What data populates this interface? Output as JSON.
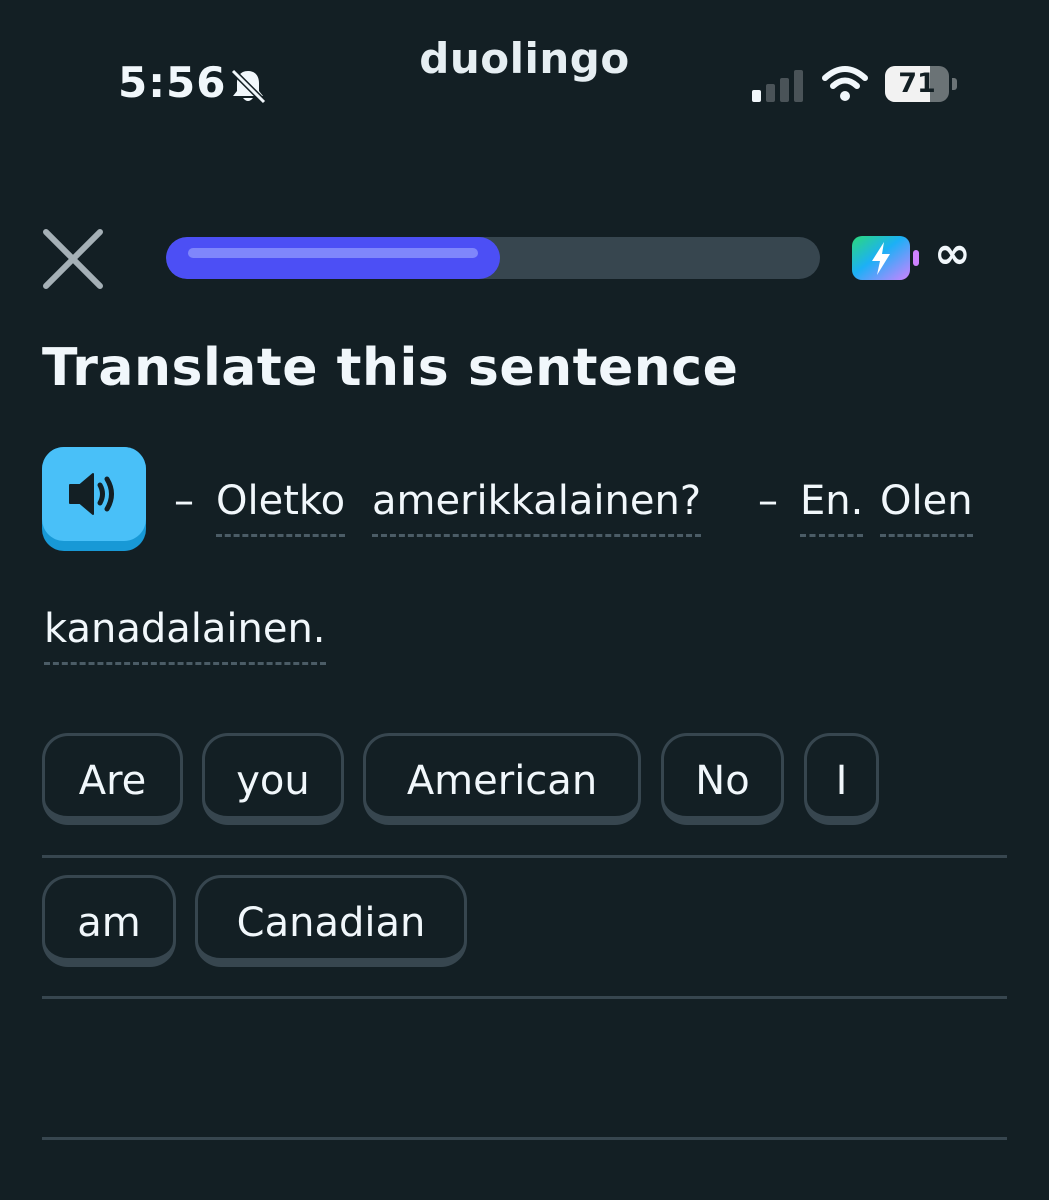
{
  "status_bar": {
    "time": "5:56",
    "brand": "duolingo",
    "battery_level": "71",
    "battery_percent": 71,
    "signal_bars_active": 1,
    "icons": [
      "bell-slash-icon",
      "cellular-signal-icon",
      "wifi-icon",
      "battery-icon"
    ]
  },
  "header": {
    "progress_fraction": 0.51,
    "infinity_symbol": "∞",
    "icons": [
      "close-icon",
      "energy-icon"
    ]
  },
  "prompt": {
    "title": "Translate this sentence"
  },
  "sentence": {
    "parts": [
      "–",
      "Oletko",
      "amerikkalainen?",
      "–",
      "En.",
      "Olen",
      "kanadalainen."
    ]
  },
  "word_bank": {
    "row1": [
      "Are",
      "you",
      "American",
      "No",
      "I"
    ],
    "row2": [
      "am",
      "Canadian"
    ]
  },
  "colors": {
    "background": "#131f24",
    "progress_fill": "#4c4ff5",
    "speaker_button": "#49c0f8",
    "chip_border": "#37464f"
  }
}
